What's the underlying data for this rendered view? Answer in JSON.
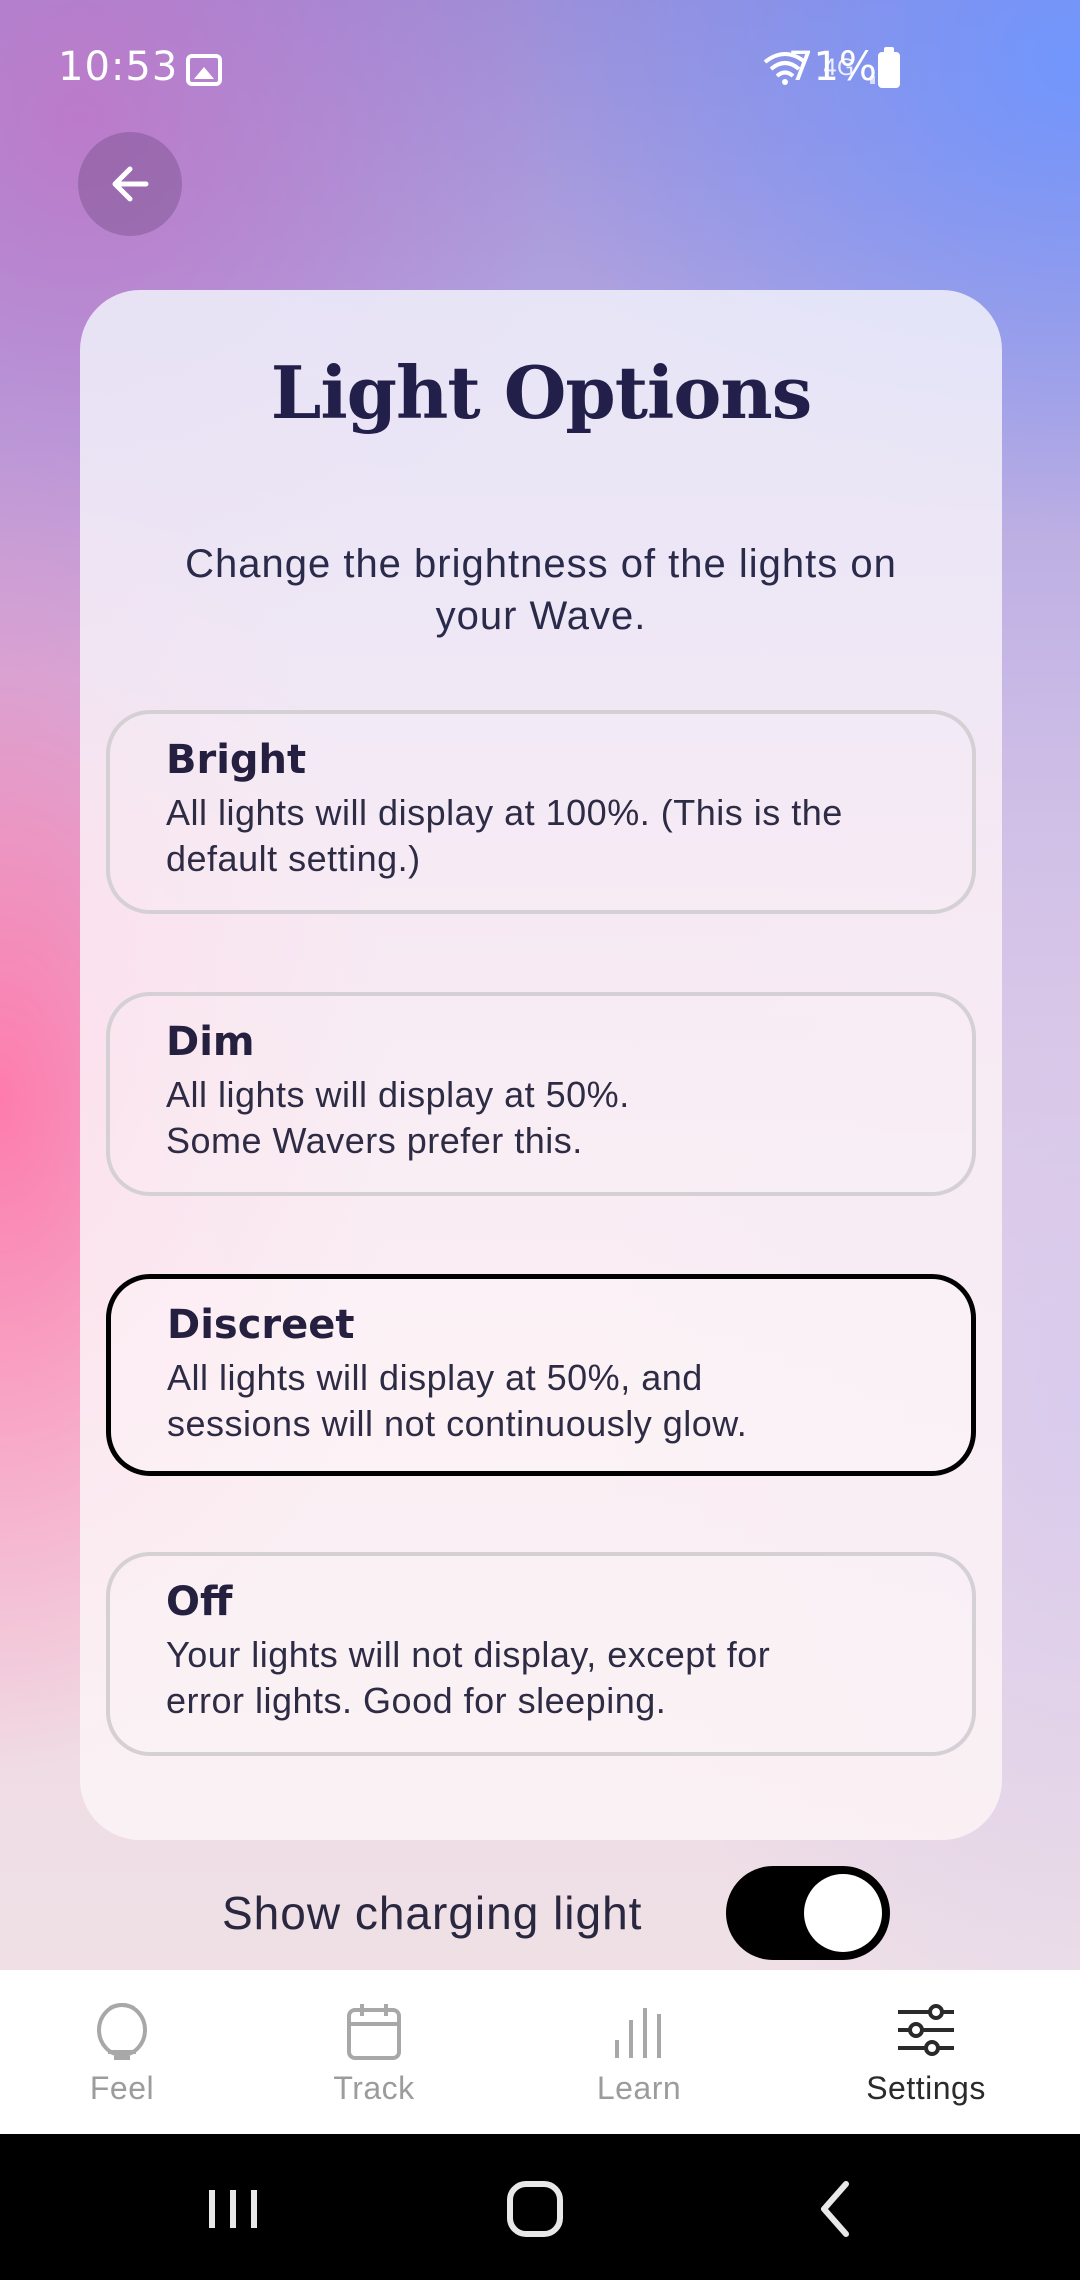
{
  "status_bar": {
    "time": "10:53",
    "network": "4G",
    "battery": "71%",
    "icons": [
      "image-icon",
      "wifi-icon",
      "signal-icon",
      "battery-icon"
    ]
  },
  "back_button": {
    "icon": "arrow-left-icon"
  },
  "card": {
    "title": "Light Options",
    "subtitle": "Change the brightness of the lights on your Wave.",
    "options": [
      {
        "title": "Bright",
        "line1": "All lights will display at 100%. (This is the",
        "line2": "default setting.)",
        "selected": false
      },
      {
        "title": "Dim",
        "line1": "All lights will display at 50%.",
        "line2": "Some Wavers prefer this.",
        "selected": false
      },
      {
        "title": "Discreet",
        "line1": "All lights will display at 50%, and",
        "line2": "sessions will not continuously glow.",
        "selected": true
      },
      {
        "title": "Off",
        "line1": "Your lights will not display, except for",
        "line2": "error lights. Good for sleeping.",
        "selected": false
      }
    ]
  },
  "charging": {
    "label": "Show charging light",
    "enabled": true
  },
  "bottom_nav": {
    "items": [
      {
        "label": "Feel",
        "icon": "wave-device-icon",
        "active": false
      },
      {
        "label": "Track",
        "icon": "calendar-icon",
        "active": false
      },
      {
        "label": "Learn",
        "icon": "bars-icon",
        "active": false
      },
      {
        "label": "Settings",
        "icon": "sliders-icon",
        "active": true
      }
    ]
  },
  "colors": {
    "accent": "#000000",
    "title": "#22204a",
    "nav_inactive": "#9c9c9c",
    "nav_active": "#2a2a2a"
  }
}
